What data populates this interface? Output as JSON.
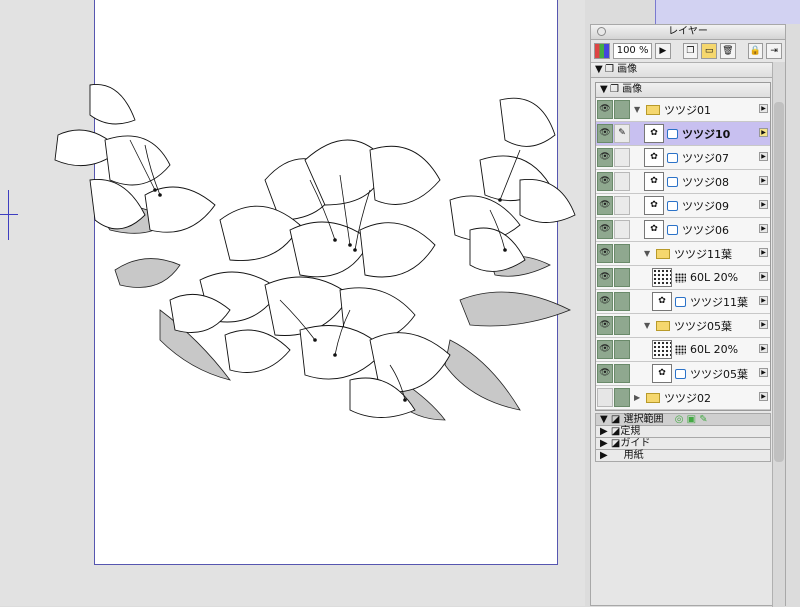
{
  "panel": {
    "title": "レイヤー",
    "zoom": "100 %",
    "section_image": "画像",
    "group_image": "画像"
  },
  "layers": [
    {
      "name": "ツツジ01",
      "kind": "folder",
      "level": 0,
      "expanded": true,
      "eye": true,
      "lock": "on"
    },
    {
      "name": "ツツジ10",
      "kind": "raster",
      "level": 1,
      "selected": true,
      "eye": true,
      "lock": "brush"
    },
    {
      "name": "ツツジ07",
      "kind": "raster",
      "level": 1,
      "eye": true,
      "lock": "off"
    },
    {
      "name": "ツツジ08",
      "kind": "raster",
      "level": 1,
      "eye": true,
      "lock": "off"
    },
    {
      "name": "ツツジ09",
      "kind": "raster",
      "level": 1,
      "eye": true,
      "lock": "off"
    },
    {
      "name": "ツツジ06",
      "kind": "raster",
      "level": 1,
      "eye": true,
      "lock": "off"
    },
    {
      "name": "ツツジ11葉",
      "kind": "folder",
      "level": 1,
      "expanded": true,
      "eye": true,
      "lock": "on"
    },
    {
      "name": "60L 20%",
      "kind": "tone",
      "level": 2,
      "eye": true,
      "lock": "on"
    },
    {
      "name": "ツツジ11葉",
      "kind": "raster",
      "level": 2,
      "eye": true,
      "lock": "on"
    },
    {
      "name": "ツツジ05葉",
      "kind": "folder",
      "level": 1,
      "expanded": true,
      "eye": true,
      "lock": "on"
    },
    {
      "name": "60L 20%",
      "kind": "tone",
      "level": 2,
      "eye": true,
      "lock": "on"
    },
    {
      "name": "ツツジ05葉",
      "kind": "raster",
      "level": 2,
      "eye": true,
      "lock": "on"
    },
    {
      "name": "ツツジ02",
      "kind": "folder",
      "level": 0,
      "expanded": false,
      "eye": false,
      "lock": "on"
    }
  ],
  "sections": [
    {
      "label": "選択範囲",
      "expanded": true
    },
    {
      "label": "定規",
      "expanded": false
    },
    {
      "label": "ガイド",
      "expanded": false
    },
    {
      "label": "用紙",
      "expanded": false
    }
  ],
  "colors": {
    "selection": "#c8c0f0",
    "visible_toggle": "#8fa88f",
    "page_border": "#5656b0"
  }
}
